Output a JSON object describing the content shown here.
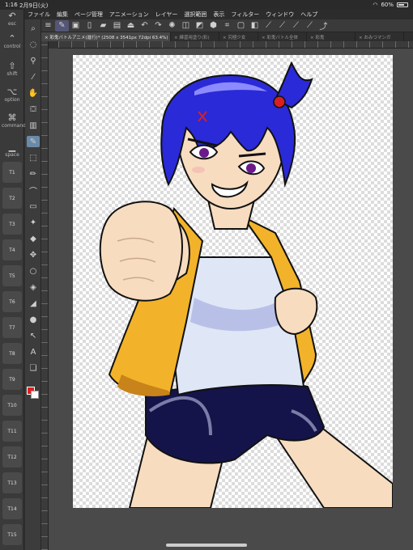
{
  "status": {
    "time": "1:16",
    "date": "2月9日(火)",
    "battery": "60%"
  },
  "menu": [
    "ファイル",
    "編集",
    "ページ管理",
    "アニメーション",
    "レイヤー",
    "選択範囲",
    "表示",
    "フィルター",
    "ウィンドウ",
    "ヘルプ"
  ],
  "leftbar": {
    "keys": [
      {
        "label": "esc",
        "icon": "undo-icon"
      },
      {
        "label": "control",
        "icon": "control-icon"
      },
      {
        "label": "shift",
        "icon": "shift-icon"
      },
      {
        "label": "option",
        "icon": "option-icon"
      },
      {
        "label": "command",
        "icon": "command-icon"
      },
      {
        "label": "space",
        "icon": "space-icon"
      }
    ],
    "tkeys": [
      "T1",
      "T2",
      "T3",
      "T4",
      "T5",
      "T6",
      "T7",
      "T8",
      "T9",
      "T10",
      "T11",
      "T12",
      "T13",
      "T14",
      "T15"
    ]
  },
  "tabs": [
    {
      "label": "× 彩鬼バトルアニメ(進行)* (2508 x 3541px 72dpi 63.4%)",
      "active": true
    },
    {
      "label": "× 練習用塗り(彩)",
      "active": false
    },
    {
      "label": "× 究極少女",
      "active": false
    },
    {
      "label": "× 彩鬼バトル全体",
      "active": false
    },
    {
      "label": "× 彩鬼",
      "active": false
    },
    {
      "label": "× おみつマンガ",
      "active": false
    }
  ],
  "colors": {
    "main": "#e02020",
    "sub": "#ffffff",
    "hair": "#2a2ad8",
    "vest": "#f2b32a",
    "shirt": "#dfe6f6",
    "shorts": "#14144a",
    "skin": "#f7dcc0"
  }
}
